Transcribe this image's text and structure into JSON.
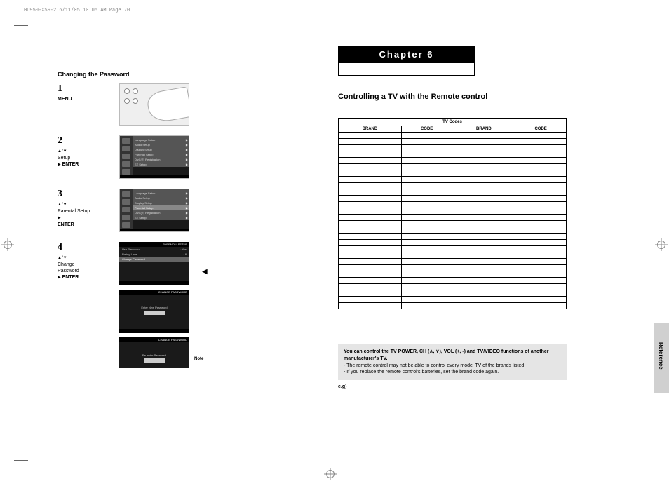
{
  "header": "HD950-XSS-2  6/11/05  10:05 AM  Page 70",
  "left": {
    "section_title": "Changing the Password",
    "steps": [
      {
        "num": "1",
        "label": "MENU"
      },
      {
        "num": "2",
        "sym": "▲/▼",
        "label1": "Setup",
        "sym2": "▶",
        "label2": "ENTER"
      },
      {
        "num": "3",
        "sym": "▲/▼",
        "label1": "Parental Setup",
        "sym2": "▶",
        "label2": "ENTER"
      },
      {
        "num": "4",
        "sym": "▲/▼",
        "label1": "Change",
        "label1b": "Password",
        "sym2": "▶",
        "label2": "ENTER"
      }
    ],
    "menu_items": [
      "Language Setup",
      "Audio Setup",
      "Display Setup",
      "Parental Setup",
      "DivX(R) Registration",
      "EZ Setup"
    ],
    "parental_rows": [
      {
        "k": "Use Password",
        "v": ": Yes"
      },
      {
        "k": "Rating Level",
        "v": ": 8"
      },
      {
        "k": "Change Password",
        "v": ""
      }
    ],
    "screen_hdr_parental": "PARENTAL SETUP",
    "screen_hdr_change": "CHANGE PASSWORD",
    "enter_new": "Enter New Password",
    "reenter": "Re-enter Password",
    "note": "Note"
  },
  "right": {
    "chapter": "Chapter 6",
    "title": "Controlling a TV with the Remote control",
    "table_title": "TV Codes",
    "col_brand": "BRAND",
    "col_code": "CODE",
    "info_line1a": "You can control the TV POWER, CH (",
    "info_ch_up": "∧",
    "info_ch_sep": ", ",
    "info_ch_dn": "∨",
    "info_line1b": "), VOL (+, -) and TV/VIDEO functions of another manufacturer's TV.",
    "info_line2": "- The remote control may not be able to control every model TV of the brands listed.",
    "info_line3": "- If you replace the remote control's batteries, set the brand code again.",
    "eg": "e.g)",
    "side_tab": "Reference",
    "empty_rows": 28
  },
  "arrow_back": "◀"
}
